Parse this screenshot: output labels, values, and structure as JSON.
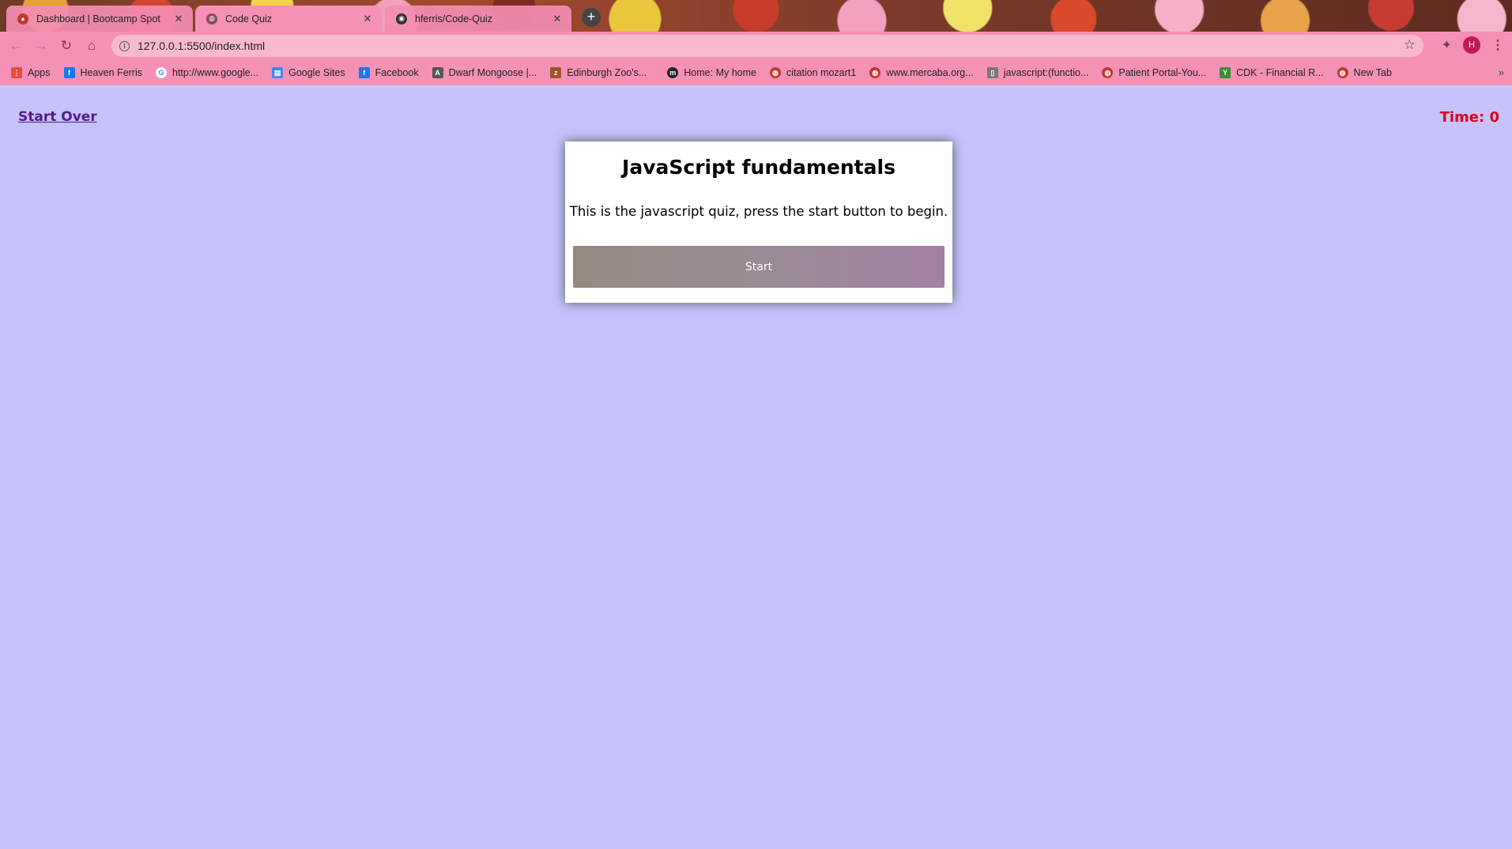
{
  "browser": {
    "tabs": [
      {
        "title": "Dashboard | Bootcamp Spot",
        "favicon": "bootcamp-icon",
        "active": false
      },
      {
        "title": "Code Quiz",
        "favicon": "globe-icon",
        "active": true
      },
      {
        "title": "hferris/Code-Quiz",
        "favicon": "github-icon",
        "active": false
      }
    ],
    "url": "127.0.0.1:5500/index.html",
    "profile_initial": "H",
    "bookmarks": [
      {
        "label": "Apps",
        "icon": "apps-grid-icon",
        "color": "#e74c3c"
      },
      {
        "label": "Heaven Ferris",
        "icon": "facebook-icon",
        "color": "#1877f2"
      },
      {
        "label": "http://www.google...",
        "icon": "google-icon",
        "color": "#4285f4"
      },
      {
        "label": "Google Sites",
        "icon": "google-sites-icon",
        "color": "#4285f4"
      },
      {
        "label": "Facebook",
        "icon": "facebook-icon",
        "color": "#1877f2"
      },
      {
        "label": "Dwarf Mongoose |...",
        "icon": "awf-icon",
        "color": "#555555"
      },
      {
        "label": "Edinburgh Zoo's...",
        "icon": "zoo-icon",
        "color": "#a0522d"
      },
      {
        "label": "Home: My home",
        "icon": "m-logo-icon",
        "color": "#222222"
      },
      {
        "label": "citation mozart1",
        "icon": "globe-icon",
        "color": "#c0392b"
      },
      {
        "label": "www.mercaba.org...",
        "icon": "globe-icon",
        "color": "#c0392b"
      },
      {
        "label": "javascript:(functio...",
        "icon": "bookmarklet-icon",
        "color": "#777777"
      },
      {
        "label": "Patient Portal-You...",
        "icon": "globe-icon",
        "color": "#c0392b"
      },
      {
        "label": "CDK - Financial R...",
        "icon": "cdk-icon",
        "color": "#3a8d3a"
      },
      {
        "label": "New Tab",
        "icon": "globe-icon",
        "color": "#c0392b"
      }
    ]
  },
  "page": {
    "start_over": "Start Over",
    "timer": "Time: 0",
    "quiz": {
      "title": "JavaScript fundamentals",
      "description": "This is the javascript quiz, press the start button to begin.",
      "start_label": "Start"
    }
  }
}
